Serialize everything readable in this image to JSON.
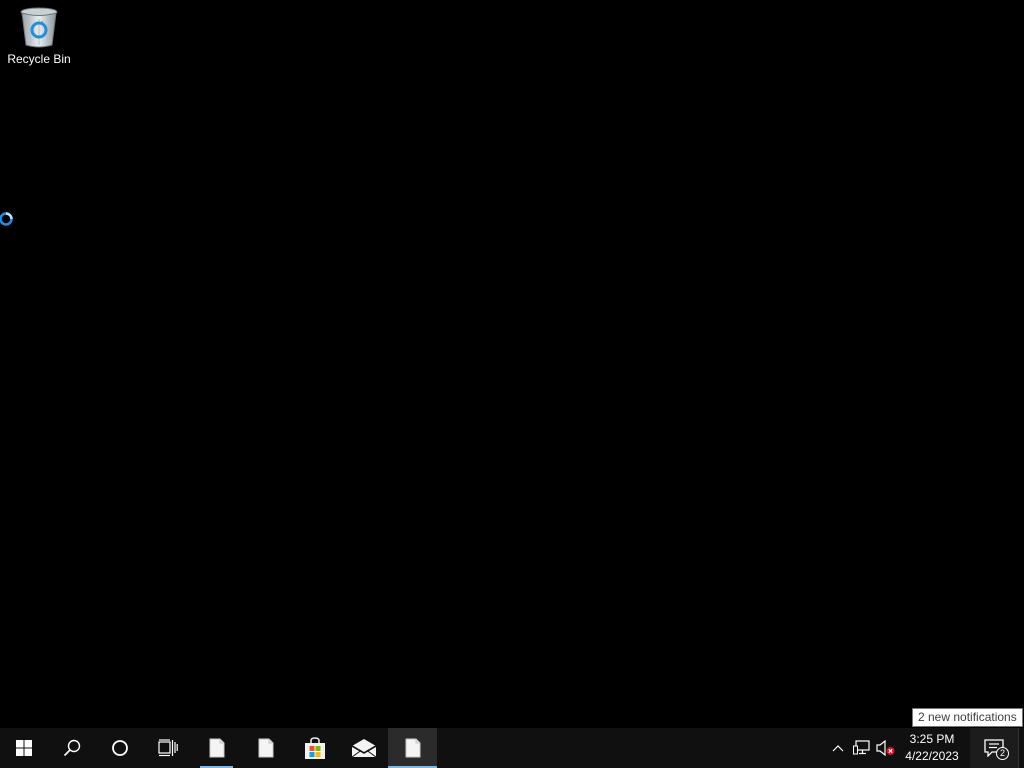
{
  "desktop": {
    "icons": [
      {
        "label": "Recycle Bin",
        "icon": "recycle-bin-icon"
      }
    ]
  },
  "taskbar": {
    "buttons": [
      {
        "name": "start-button",
        "icon": "windows-logo-icon"
      },
      {
        "name": "search-button",
        "icon": "search-icon"
      },
      {
        "name": "cortana-button",
        "icon": "circle-icon"
      },
      {
        "name": "task-view-button",
        "icon": "task-view-icon"
      },
      {
        "name": "taskbar-app-document-1",
        "icon": "document-icon",
        "running": true,
        "active": false
      },
      {
        "name": "taskbar-app-document-2",
        "icon": "document-icon",
        "running": false,
        "active": false
      },
      {
        "name": "taskbar-app-store",
        "icon": "store-icon",
        "running": false,
        "active": false
      },
      {
        "name": "taskbar-app-mail",
        "icon": "mail-icon",
        "running": false,
        "active": false
      },
      {
        "name": "taskbar-app-document-3",
        "icon": "document-icon",
        "running": true,
        "active": true
      }
    ],
    "tray": {
      "clock_time": "3:25 PM",
      "clock_date": "4/22/2023",
      "notification_count": "2",
      "tooltip": "2 new notifications"
    }
  },
  "colors": {
    "desktop_background": "#000000",
    "taskbar_background": "#101010",
    "accent": "#76b9ed"
  }
}
